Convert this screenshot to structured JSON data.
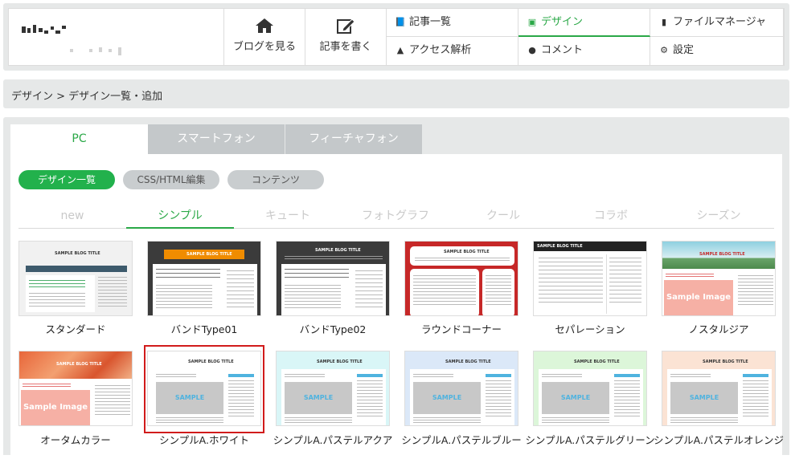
{
  "header": {
    "big_buttons": [
      {
        "label": "ブログを見る",
        "icon": "home-icon"
      },
      {
        "label": "記事を書く",
        "icon": "edit-icon"
      }
    ],
    "menu": [
      {
        "label": "記事一覧",
        "icon": "book-icon",
        "active": false
      },
      {
        "label": "デザイン",
        "icon": "image-icon",
        "active": true
      },
      {
        "label": "ファイルマネージャ",
        "icon": "file-icon",
        "active": false
      },
      {
        "label": "アクセス解析",
        "icon": "chart-icon",
        "active": false
      },
      {
        "label": "コメント",
        "icon": "comment-icon",
        "active": false
      },
      {
        "label": "設定",
        "icon": "gear-icon",
        "active": false
      }
    ]
  },
  "breadcrumb": "デザイン > デザイン一覧・追加",
  "device_tabs": [
    {
      "label": "PC",
      "active": true
    },
    {
      "label": "スマートフォン",
      "active": false
    },
    {
      "label": "フィーチャフォン",
      "active": false
    }
  ],
  "pills": [
    {
      "label": "デザイン一覧",
      "active": true
    },
    {
      "label": "CSS/HTML編集",
      "active": false
    },
    {
      "label": "コンテンツ",
      "active": false
    }
  ],
  "categories": [
    {
      "label": "new",
      "active": false
    },
    {
      "label": "シンプル",
      "active": true
    },
    {
      "label": "キュート",
      "active": false
    },
    {
      "label": "フォトグラフ",
      "active": false
    },
    {
      "label": "クール",
      "active": false
    },
    {
      "label": "コラボ",
      "active": false
    },
    {
      "label": "シーズン",
      "active": false
    }
  ],
  "thumb_text": {
    "blog_title": "SAMPLE BLOG TITLE",
    "sample": "SAMPLE",
    "sample_image": "Sample Image"
  },
  "designs": [
    {
      "name": "スタンダード",
      "style": "standard"
    },
    {
      "name": "バンドType01",
      "style": "band1"
    },
    {
      "name": "バンドType02",
      "style": "band2"
    },
    {
      "name": "ラウンドコーナー",
      "style": "round"
    },
    {
      "name": "セパレーション",
      "style": "separation"
    },
    {
      "name": "ノスタルジア",
      "style": "nostalgia"
    },
    {
      "name": "オータムカラー",
      "style": "autumn"
    },
    {
      "name": "シンプルA.ホワイト",
      "style": "simple",
      "bg": "#ffffff",
      "selected": true
    },
    {
      "name": "シンプルA.パステルアクア",
      "style": "simple",
      "bg": "#d9f6f7"
    },
    {
      "name": "シンプルA.パステルブルー",
      "style": "simple",
      "bg": "#dbe8f8"
    },
    {
      "name": "シンプルA.パステルグリーン",
      "style": "simple",
      "bg": "#dcf6d9"
    },
    {
      "name": "シンプルA.パステルオレンジ",
      "style": "simple",
      "bg": "#fbe3d4"
    }
  ],
  "colors": {
    "accent": "#2aa847",
    "pill_active": "#22b14c",
    "selected_border": "#d11b1b",
    "panel_bg": "#e6e8e8"
  }
}
